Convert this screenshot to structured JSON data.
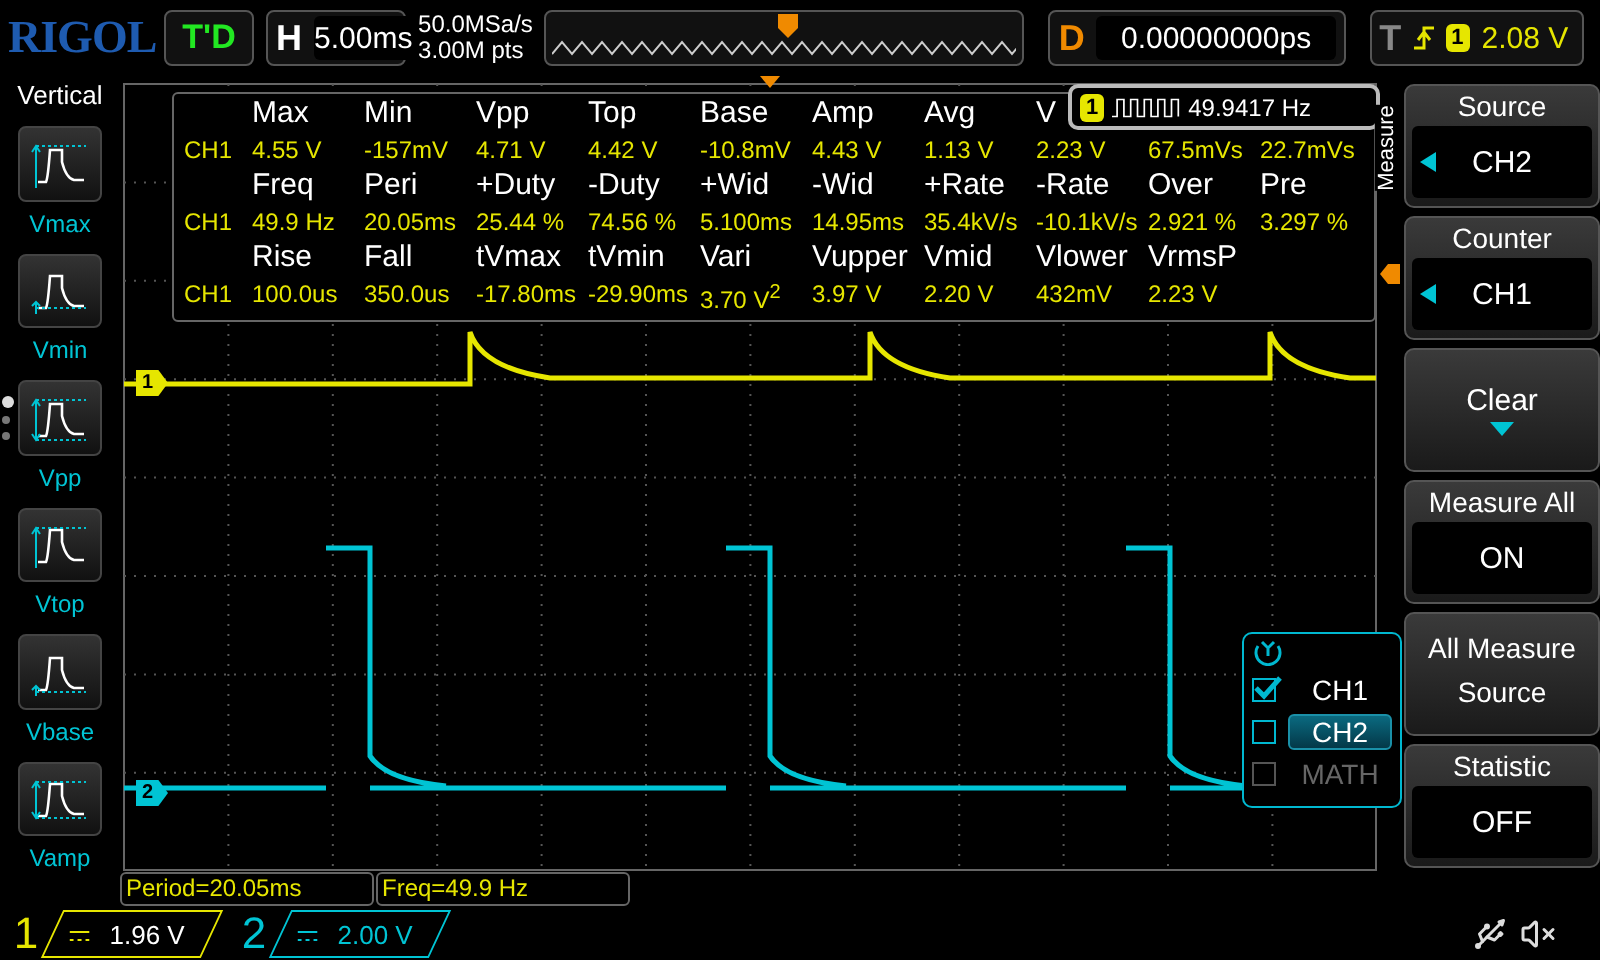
{
  "top_bar": {
    "logo": "RIGOL",
    "run_status": "T'D",
    "timebase": {
      "label": "H",
      "value": "5.00ms"
    },
    "sample_rate": "50.0MSa/s",
    "memory_depth": "3.00M pts",
    "delay": {
      "label": "D",
      "value": "0.00000000ps"
    },
    "trigger": {
      "label": "T",
      "source": "1",
      "level": "2.08 V"
    }
  },
  "left_panel": {
    "title": "Vertical",
    "items": [
      {
        "label": "Vmax",
        "kind": "max"
      },
      {
        "label": "Vmin",
        "kind": "min"
      },
      {
        "label": "Vpp",
        "kind": "pp"
      },
      {
        "label": "Vtop",
        "kind": "top"
      },
      {
        "label": "Vbase",
        "kind": "base"
      },
      {
        "label": "Vamp",
        "kind": "amp"
      }
    ],
    "pages": [
      {
        "selected": true
      },
      {
        "selected": false
      },
      {
        "selected": false
      }
    ]
  },
  "measurement_table": {
    "groups": [
      {
        "headers": [
          "Max",
          "Min",
          "Vpp",
          "Top",
          "Base",
          "Amp",
          "Avg",
          "V"
        ],
        "source": "CH1",
        "values": [
          "4.55 V",
          "-157mV",
          "4.71 V",
          "4.42 V",
          "-10.8mV",
          "4.43 V",
          "1.13 V",
          "2.23 V",
          "67.5mVs",
          "22.7mVs"
        ]
      },
      {
        "headers": [
          "Freq",
          "Peri",
          "+Duty",
          "-Duty",
          "+Wid",
          "-Wid",
          "+Rate",
          "-Rate",
          "Over",
          "Pre"
        ],
        "source": "CH1",
        "values": [
          "49.9 Hz",
          "20.05ms",
          "25.44 %",
          "74.56 %",
          "5.100ms",
          "14.95ms",
          "35.4kV/s",
          "-10.1kV/s",
          "2.921 %",
          "3.297 %"
        ]
      },
      {
        "headers": [
          "Rise",
          "Fall",
          "tVmax",
          "tVmin",
          "Vari",
          "Vupper",
          "Vmid",
          "Vlower",
          "VrmsP"
        ],
        "source": "CH1",
        "values": [
          "100.0us",
          "350.0us",
          "-17.80ms",
          "-29.90ms",
          "3.70 V$^{2}$",
          "3.97 V",
          "2.20 V",
          "432mV",
          "2.23 V"
        ]
      }
    ]
  },
  "counter": {
    "channel": "1",
    "value": "49.9417 Hz"
  },
  "measure_tab": "Measure",
  "channels": [
    {
      "marker": "1",
      "number": "1",
      "scale": "1.96 V",
      "color": "#e6e600"
    },
    {
      "marker": "2",
      "number": "2",
      "scale": "2.00 V",
      "color": "#00c4d4"
    }
  ],
  "right_menu": [
    {
      "kind": "knob",
      "label": "Source",
      "value": "CH2"
    },
    {
      "kind": "knob",
      "label": "Counter",
      "value": "CH1"
    },
    {
      "kind": "action",
      "label": "Clear"
    },
    {
      "kind": "toggle",
      "label": "Measure All",
      "value": "ON"
    },
    {
      "kind": "submenu",
      "label": "All Measure Source"
    },
    {
      "kind": "toggle",
      "label": "Statistic",
      "value": "OFF"
    }
  ],
  "source_popup": {
    "items": [
      {
        "label": "CH1",
        "checked": true,
        "selected": false,
        "disabled": false
      },
      {
        "label": "CH2",
        "checked": false,
        "selected": true,
        "disabled": false
      },
      {
        "label": "MATH",
        "checked": false,
        "selected": false,
        "disabled": true
      }
    ]
  },
  "cursor_readouts": [
    "Period=20.05ms",
    "Freq=49.9 Hz"
  ]
}
